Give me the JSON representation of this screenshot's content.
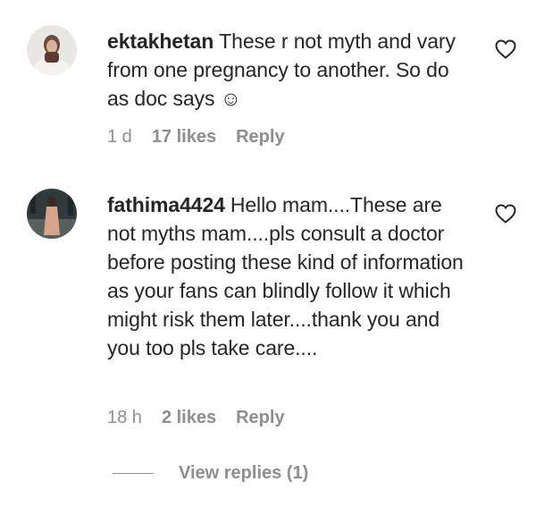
{
  "comments": [
    {
      "username": "ektakhetan",
      "text": "These r not myth and vary from one pregnancy to another. So do as doc says ☺",
      "time": "1 d",
      "likes": "17 likes",
      "reply": "Reply",
      "avatar_icon": "user-avatar",
      "like_icon": "heart-icon"
    },
    {
      "username": "fathima4424",
      "text": "Hello mam....These are not myths mam....pls consult a doctor before posting these kind of information as your fans can blindly follow it which might risk them later....thank you and you too pls take care....",
      "time": "18 h",
      "likes": "2 likes",
      "reply": "Reply",
      "avatar_icon": "user-avatar",
      "like_icon": "heart-icon"
    }
  ],
  "view_replies": "View replies (1)",
  "colors": {
    "text": "#262626",
    "meta": "#8e8e8e"
  }
}
